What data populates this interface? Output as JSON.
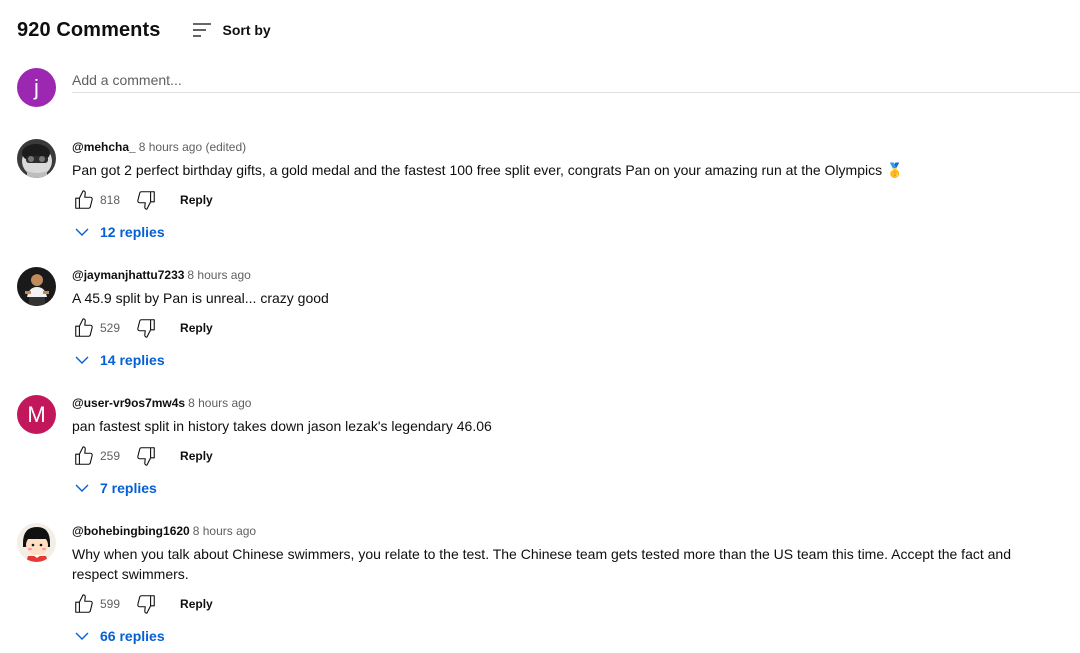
{
  "header": {
    "comment_count": "920 Comments",
    "sort_label": "Sort by"
  },
  "add_comment": {
    "avatar_letter": "j",
    "avatar_color": "#9c27b0",
    "placeholder": "Add a comment..."
  },
  "colors": {
    "replies_link": "#065fd4",
    "muted_text": "#606060",
    "avatar_m": "#c2185b"
  },
  "comments": [
    {
      "author": "@mehcha_",
      "time": "8 hours ago (edited)",
      "text": "Pan got 2 perfect birthday gifts, a gold medal and the fastest 100 free split ever, congrats Pan on your amazing run at the Olympics",
      "emoji": "🥇",
      "likes": "818",
      "reply_label": "Reply",
      "replies": "12 replies",
      "avatar": "photo-bw-face"
    },
    {
      "author": "@jaymanjhattu7233",
      "time": "8 hours ago",
      "text": "A 45.9 split by Pan is unreal... crazy good",
      "likes": "529",
      "reply_label": "Reply",
      "replies": "14 replies",
      "avatar": "photo-person"
    },
    {
      "author": "@user-vr9os7mw4s",
      "time": "8 hours ago",
      "text": "pan fastest split in history takes down jason lezak's legendary 46.06",
      "likes": "259",
      "reply_label": "Reply",
      "replies": "7 replies",
      "avatar": "letter",
      "avatar_letter": "M"
    },
    {
      "author": "@bohebingbing1620",
      "time": "8 hours ago",
      "text": "Why when you talk about Chinese swimmers, you relate to the test. The Chinese team gets tested more than the US team this time. Accept the fact and respect swimmers.",
      "likes": "599",
      "reply_label": "Reply",
      "replies": "66 replies",
      "avatar": "cartoon-girl"
    }
  ]
}
